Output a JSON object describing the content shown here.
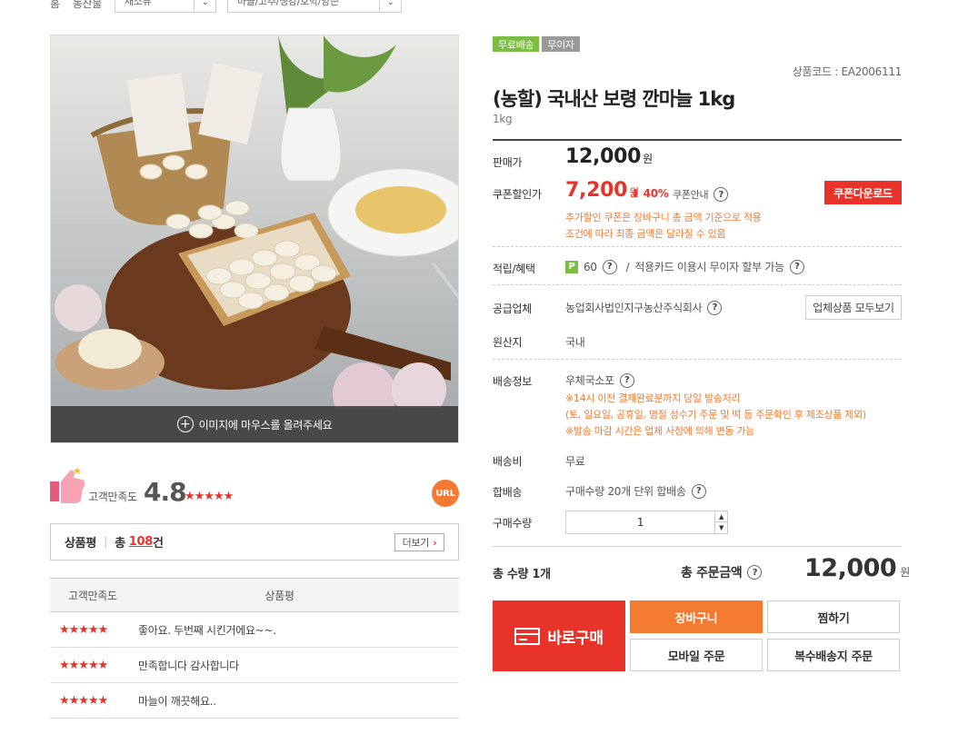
{
  "breadcrumb": {
    "home": "홈",
    "category": "농산물",
    "select1": "채소류",
    "select2": "마늘/고추/생강/호박/양촌"
  },
  "image": {
    "hover_hint": "이미지에 마우스를 올려주세요"
  },
  "satisfaction": {
    "label": "고객만족도",
    "score": "4.8",
    "stars": "★★★★★",
    "url_label": "URL"
  },
  "reviews": {
    "title": "상품평",
    "total_prefix": "총",
    "count": "108",
    "count_unit": "건",
    "more_label": "더보기",
    "col_rating": "고객만족도",
    "col_review": "상품평",
    "items": [
      {
        "stars": "★★★★★",
        "text": "좋아요. 두번째 시킨거에요~~."
      },
      {
        "stars": "★★★★★",
        "text": "만족합니다 감사합니다"
      },
      {
        "stars": "★★★★★",
        "text": "마늘이 깨끗해요.."
      }
    ]
  },
  "product": {
    "badges": [
      "무료배송",
      "무이자"
    ],
    "code_label": "상품코드 : EA2006111",
    "title": "(농할) 국내산 보령 깐마늘 1kg",
    "subtitle": "1kg",
    "sale_label": "판매가",
    "sale_price": "12,000",
    "won": "원",
    "coupon_label": "쿠폰할인가",
    "coupon_price": "7,200",
    "discount": "40%",
    "coupon_guide": "쿠폰안내",
    "coupon_download": "쿠폰다운로드",
    "coupon_note1": "추가할인 쿠폰은 장바구니 총 금액 기준으로 적용",
    "coupon_note2": "조건에 따라 최종 금액은 달라질 수 있음",
    "points_label": "적립/혜택",
    "points_value": "60",
    "points_extra": "적용카드 이용시 무이자 할부 가능",
    "supplier_label": "공급업체",
    "supplier_value": "농업회사법인지구농산주식회사",
    "supplier_all": "업체상품 모두보기",
    "origin_label": "원산지",
    "origin_value": "국내",
    "shipping_label": "배송정보",
    "shipping_value": "우체국소포",
    "ship_note1": "※14시 이전 결제완료분까지 당일 발송처리",
    "ship_note2": "(토, 일요일, 공휴일, 명절 성수기 주문 및 떡 등 주문확인 후 제조상품 제외)",
    "ship_note3": "※발송 마감 시간은 업체 사정에 의해 변동 가능",
    "fee_label": "배송비",
    "fee_value": "무료",
    "combine_label": "합배송",
    "combine_value": "구매수량 20개 단위 합배송",
    "qty_label": "구매수량",
    "qty_value": "1",
    "total_qty": "총 수량 1개",
    "total_label": "총 주문금액",
    "total_price": "12,000"
  },
  "actions": {
    "buy_now": "바로구매",
    "cart": "장바구니",
    "wish": "찜하기",
    "mobile": "모바일 주문",
    "multi": "복수배송지 주문"
  },
  "colors": {
    "accent_red": "#e8332a",
    "accent_orange": "#f47a32",
    "badge_green": "#7bbd42"
  }
}
